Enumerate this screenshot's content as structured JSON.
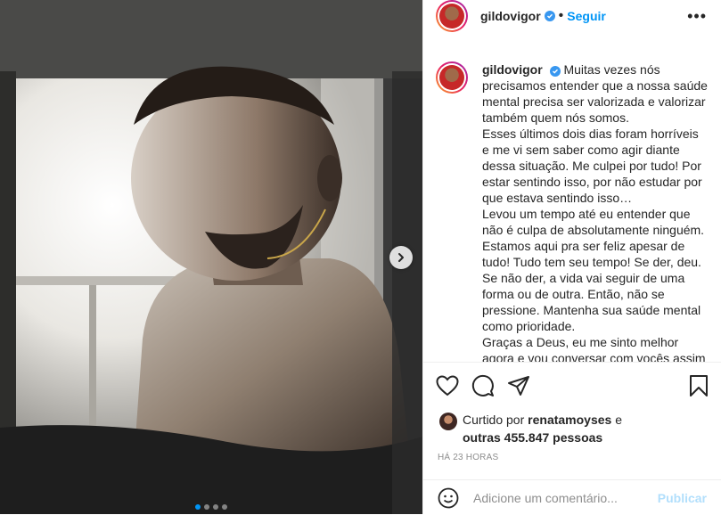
{
  "post": {
    "username": "gildovigor",
    "follow_label": "Seguir",
    "more_label": "•••",
    "caption": "Muitas vezes nós precisamos entender que a nossa saúde mental precisa ser valorizada e valorizar também quem nós somos.\nEsses últimos dois dias foram horríveis e me vi sem saber como agir diante dessa situação. Me culpei por tudo! Por estar sentindo isso, por não estudar por que estava sentindo isso…\nLevou um tempo até eu entender que não é culpa de absolutamente ninguém. Estamos aqui pra ser feliz apesar de tudo! Tudo tem seu tempo! Se der, deu. Se não der, a vida vai seguir de uma forma ou de outra. Então, não se pressione. Mantenha sua saúde mental como prioridade.\nGraças a Deus, eu me sinto melhor agora e vou conversar com vocês assim que der",
    "carousel": {
      "total": 4,
      "current": 1
    }
  },
  "likes": {
    "prefix": "Curtido por",
    "user": "renatamoyses",
    "connector": "e",
    "others": "outras 455.847 pessoas"
  },
  "timestamp": "HÁ 23 HORAS",
  "comment": {
    "placeholder": "Adicione um comentário...",
    "publish_label": "Publicar"
  },
  "colors": {
    "accent": "#0095f6",
    "verified": "#3897f0",
    "muted": "#8e8e8e",
    "publish_disabled": "#b2dffc"
  },
  "icons": [
    "verified-icon",
    "chevron-right-icon",
    "heart-icon",
    "comment-icon",
    "share-icon",
    "bookmark-icon",
    "emoji-icon"
  ]
}
